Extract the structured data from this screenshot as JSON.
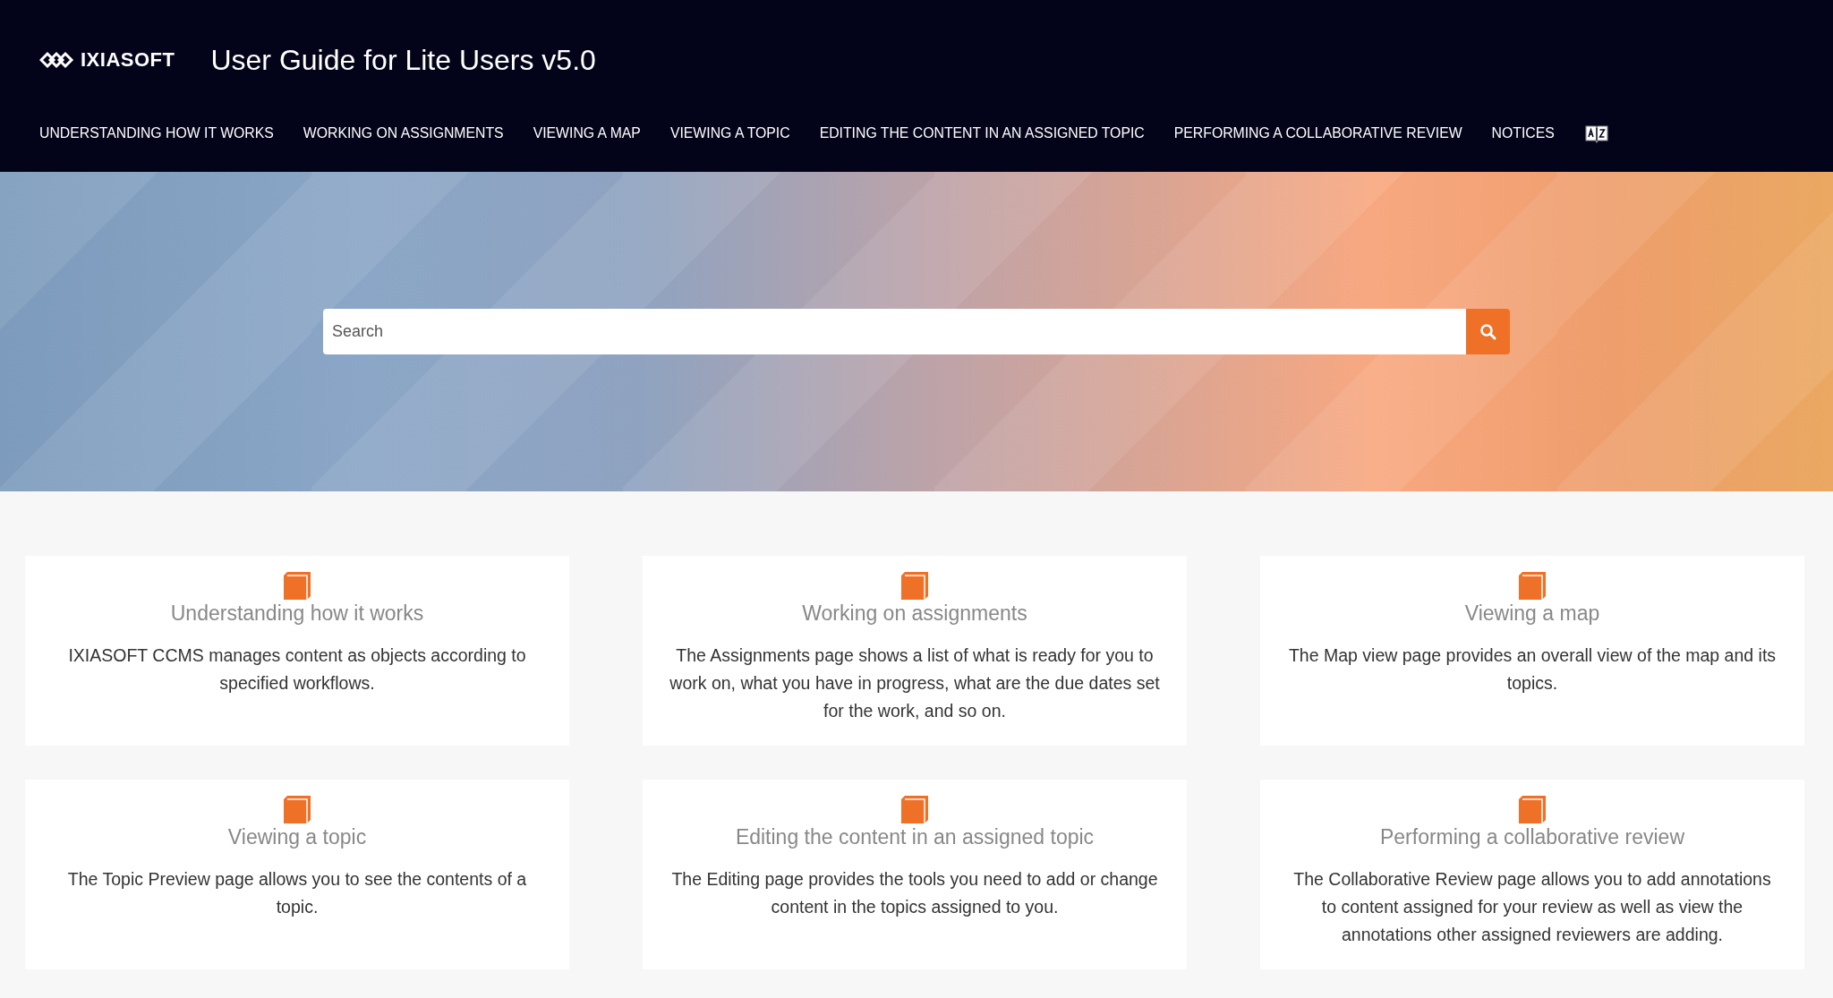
{
  "header": {
    "logo": "IXIASOFT",
    "title": "User Guide for Lite Users v5.0"
  },
  "nav": [
    {
      "label": "UNDERSTANDING HOW IT WORKS"
    },
    {
      "label": "WORKING ON ASSIGNMENTS"
    },
    {
      "label": "VIEWING A MAP"
    },
    {
      "label": "VIEWING A TOPIC"
    },
    {
      "label": "EDITING THE CONTENT IN AN ASSIGNED TOPIC"
    },
    {
      "label": "PERFORMING A COLLABORATIVE REVIEW"
    },
    {
      "label": "NOTICES"
    }
  ],
  "search": {
    "placeholder": "Search"
  },
  "cards": [
    {
      "title": "Understanding how it works",
      "text": "IXIASOFT CCMS manages content as objects according to specified workflows."
    },
    {
      "title": "Working on assignments",
      "text": "The Assignments page shows a list of what is ready for you to work on, what you have in progress, what are the due dates set for the work, and so on."
    },
    {
      "title": "Viewing a map",
      "text": "The Map view page provides an overall view of the map and its topics."
    },
    {
      "title": "Viewing a topic",
      "text": "The Topic Preview page allows you to see the contents of a topic."
    },
    {
      "title": "Editing the content in an assigned topic",
      "text": "The Editing page provides the tools you need to add or change content in the topics assigned to you."
    },
    {
      "title": "Performing a collaborative review",
      "text": "The Collaborative Review page allows you to add annotations to content assigned for your review as well as view the annotations other assigned reviewers are adding."
    }
  ]
}
